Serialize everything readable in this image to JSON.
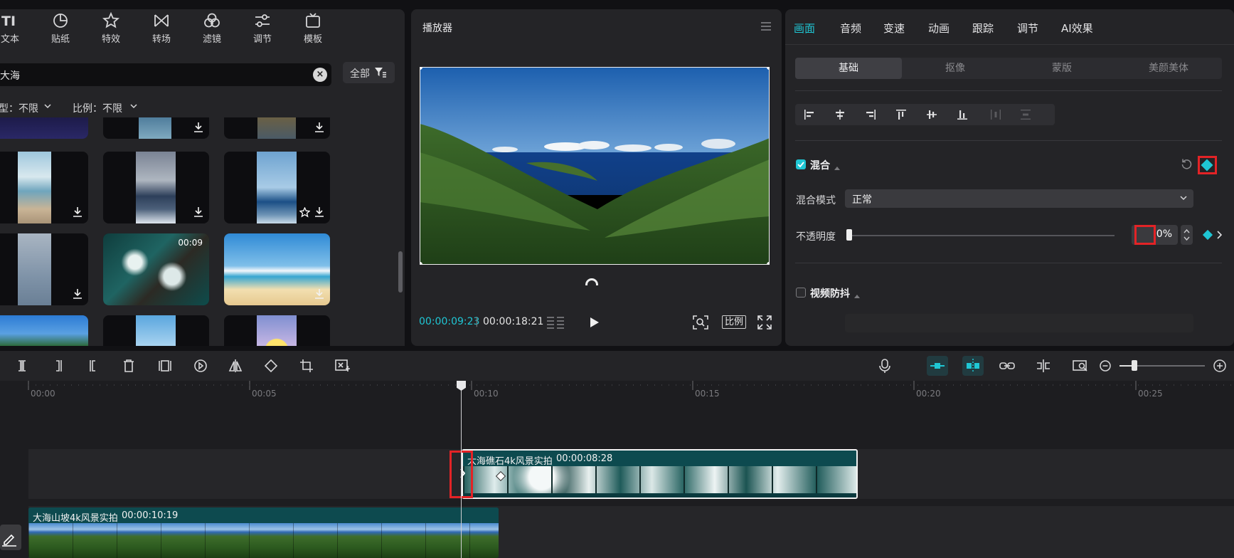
{
  "colors": {
    "accent": "#1fc6d4",
    "highlight_box": "#e32326",
    "clip_teal": "#0d4a4f"
  },
  "media": {
    "tools": [
      {
        "label": "文本",
        "icon": "text-icon"
      },
      {
        "label": "贴纸",
        "icon": "sticker-icon"
      },
      {
        "label": "特效",
        "icon": "effects-star-icon"
      },
      {
        "label": "转场",
        "icon": "transition-icon"
      },
      {
        "label": "滤镜",
        "icon": "filter-icon"
      },
      {
        "label": "调节",
        "icon": "adjust-icon"
      },
      {
        "label": "模板",
        "icon": "template-icon"
      }
    ],
    "search_value": "大海",
    "all_button": "全部",
    "filter_type": "型：不限",
    "filter_ratio": "比例：不限",
    "thumb_duration": "00:09"
  },
  "player": {
    "title": "播放器",
    "current_time": "00:00:09:23",
    "total_time": "00:00:18:21",
    "ratio_label": "比例"
  },
  "inspector": {
    "tabs": [
      "画面",
      "音频",
      "变速",
      "动画",
      "跟踪",
      "调节",
      "AI效果"
    ],
    "active_tab": "画面",
    "subtabs": [
      "基础",
      "抠像",
      "蒙版",
      "美颜美体"
    ],
    "active_subtab": "基础",
    "blend": {
      "title": "混合",
      "checked": true,
      "mode_label": "混合模式",
      "mode_value": "正常",
      "opacity_label": "不透明度",
      "opacity_value": "0%",
      "opacity_level": 0
    },
    "stabilize": {
      "title": "视频防抖",
      "checked": false
    }
  },
  "timeline": {
    "ruler_labels": [
      "00:00",
      "00:05",
      "00:10",
      "00:15",
      "00:20",
      "00:25"
    ],
    "clips": [
      {
        "name": "大海礁石4k风景实拍",
        "duration": "00:00:08:28"
      },
      {
        "name": "大海山坡4k风景实拍",
        "duration": "00:00:10:19"
      }
    ],
    "zoom_level": 0.15
  }
}
